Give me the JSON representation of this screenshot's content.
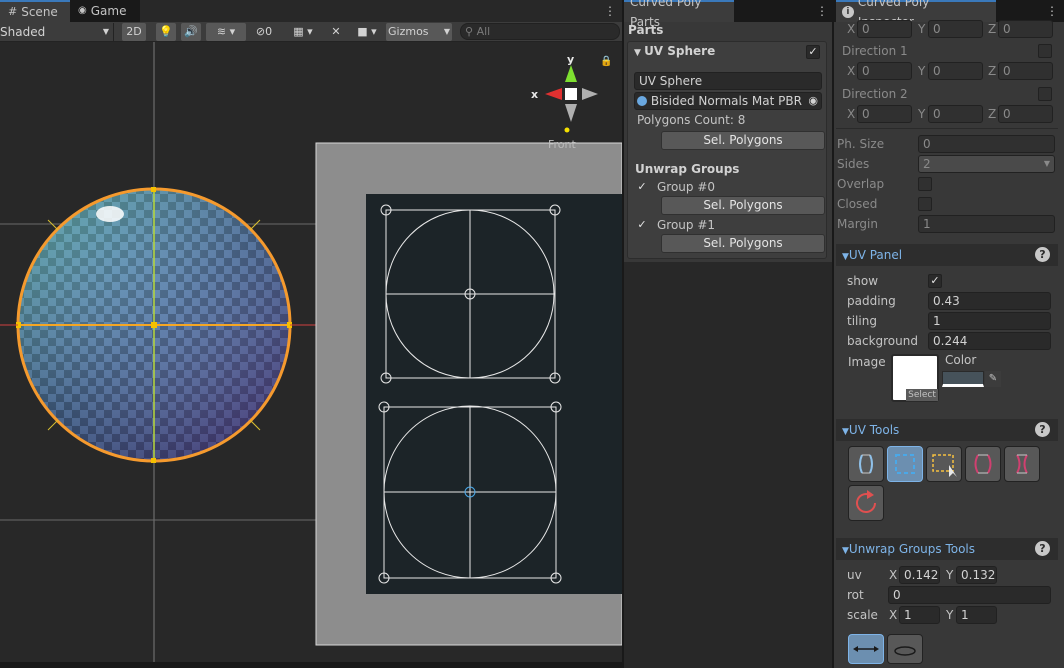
{
  "scene": {
    "tabs": [
      {
        "label": "Scene"
      },
      {
        "label": "Game"
      }
    ],
    "shading": "Shaded",
    "mode2d": "2D",
    "hidden_count": "0",
    "gizmos": "Gizmos",
    "search_placeholder": "All",
    "gizmo_labels": {
      "x": "x",
      "y": "y",
      "view": "Front"
    }
  },
  "parts_panel": {
    "title": "Curved Poly Parts",
    "section": "Parts",
    "object_name": "UV Sphere",
    "object_field": "UV Sphere",
    "material": "Bisided Normals Mat PBR",
    "polygons_count": "Polygons Count: 8",
    "sel_polygons": "Sel. Polygons",
    "unwrap_groups": "Unwrap Groups",
    "groups": [
      {
        "label": "Group #0",
        "button": "Sel. Polygons"
      },
      {
        "label": "Group #1",
        "button": "Sel. Polygons"
      }
    ]
  },
  "inspector": {
    "title": "Curved Poly Inspector",
    "top_vec": {
      "x": "0",
      "y": "0",
      "z": "0"
    },
    "direction1": {
      "label": "Direction 1",
      "x": "0",
      "y": "0",
      "z": "0"
    },
    "direction2": {
      "label": "Direction 2",
      "x": "0",
      "y": "0",
      "z": "0"
    },
    "axis": {
      "x": "X",
      "y": "Y",
      "z": "Z"
    },
    "ph_size": {
      "label": "Ph. Size",
      "value": "0"
    },
    "sides": {
      "label": "Sides",
      "value": "2"
    },
    "overlap": {
      "label": "Overlap"
    },
    "closed": {
      "label": "Closed"
    },
    "margin": {
      "label": "Margin",
      "value": "1"
    },
    "uv_panel": {
      "title": "UV Panel",
      "show": "show",
      "padding_label": "padding",
      "padding": "0.43",
      "tiling_label": "tiling",
      "tiling": "1",
      "background_label": "background",
      "background": "0.244",
      "image_label": "Image",
      "color_label": "Color",
      "select": "Select"
    },
    "uv_tools": {
      "title": "UV Tools"
    },
    "unwrap_tools": {
      "title": "Unwrap Groups Tools",
      "uv_label": "uv",
      "uv_x": "0.1427",
      "uv_y": "0.1329",
      "rot_label": "rot",
      "rot": "0",
      "scale_label": "scale",
      "scale_x": "1",
      "scale_y": "1"
    }
  },
  "colors": {
    "accent": "#3a79bb",
    "header_blue": "#7eb4e8"
  }
}
